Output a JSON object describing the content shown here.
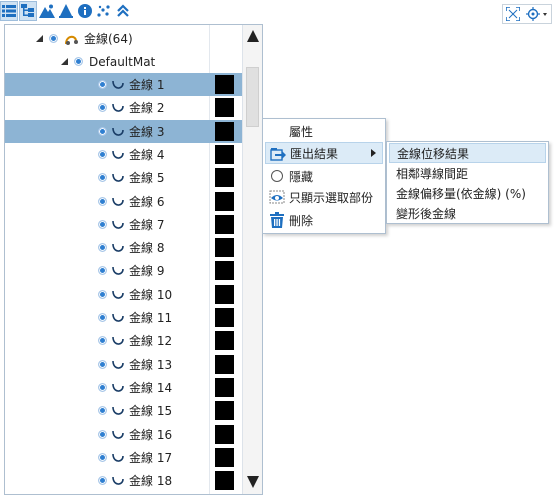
{
  "toolbar": {
    "buttons": [
      {
        "icon": "list-view-icon",
        "active": true
      },
      {
        "icon": "tree-structure-icon",
        "active": true
      },
      {
        "icon": "mountain-terrain-icon",
        "active": false
      },
      {
        "icon": "cone-icon",
        "active": false
      },
      {
        "icon": "info-icon",
        "active": false
      },
      {
        "icon": "scatter-points-icon",
        "active": false
      },
      {
        "icon": "collapse-up-icon",
        "active": false
      }
    ],
    "right_icons": [
      "fit-extents-icon",
      "target-dropdown-icon"
    ]
  },
  "tree": {
    "root_label": "金線(64)",
    "material_label": "DefaultMat",
    "items": [
      {
        "label": "金線 1",
        "selected": true,
        "color": "#000000"
      },
      {
        "label": "金線 2",
        "selected": false,
        "color": "#000000"
      },
      {
        "label": "金線 3",
        "selected": true,
        "color": "#000000"
      },
      {
        "label": "金線 4",
        "selected": false,
        "color": "#000000"
      },
      {
        "label": "金線 5",
        "selected": false,
        "color": "#000000"
      },
      {
        "label": "金線 6",
        "selected": false,
        "color": "#000000"
      },
      {
        "label": "金線 7",
        "selected": false,
        "color": "#000000"
      },
      {
        "label": "金線 8",
        "selected": false,
        "color": "#000000"
      },
      {
        "label": "金線 9",
        "selected": false,
        "color": "#000000"
      },
      {
        "label": "金線 10",
        "selected": false,
        "color": "#000000"
      },
      {
        "label": "金線 11",
        "selected": false,
        "color": "#000000"
      },
      {
        "label": "金線 12",
        "selected": false,
        "color": "#000000"
      },
      {
        "label": "金線 13",
        "selected": false,
        "color": "#000000"
      },
      {
        "label": "金線 14",
        "selected": false,
        "color": "#000000"
      },
      {
        "label": "金線 15",
        "selected": false,
        "color": "#000000"
      },
      {
        "label": "金線 16",
        "selected": false,
        "color": "#000000"
      },
      {
        "label": "金線 17",
        "selected": false,
        "color": "#000000"
      },
      {
        "label": "金線 18",
        "selected": false,
        "color": "#000000"
      }
    ]
  },
  "context_menu": {
    "items": [
      {
        "label": "屬性"
      },
      {
        "label": "匯出結果"
      },
      {
        "label": "隱藏"
      },
      {
        "label": "只顯示選取部份"
      },
      {
        "label": "刪除"
      }
    ]
  },
  "submenu": {
    "items": [
      {
        "label": "金線位移結果"
      },
      {
        "label": "相鄰導線間距"
      },
      {
        "label": "金線偏移量(依金線) (%)"
      },
      {
        "label": "變形後金線"
      }
    ]
  },
  "colors": {
    "selection": "#8db4d4",
    "menu_highlight": "#dcebf7",
    "radio": "#2f7fd1",
    "accent": "#1e6fc0"
  }
}
